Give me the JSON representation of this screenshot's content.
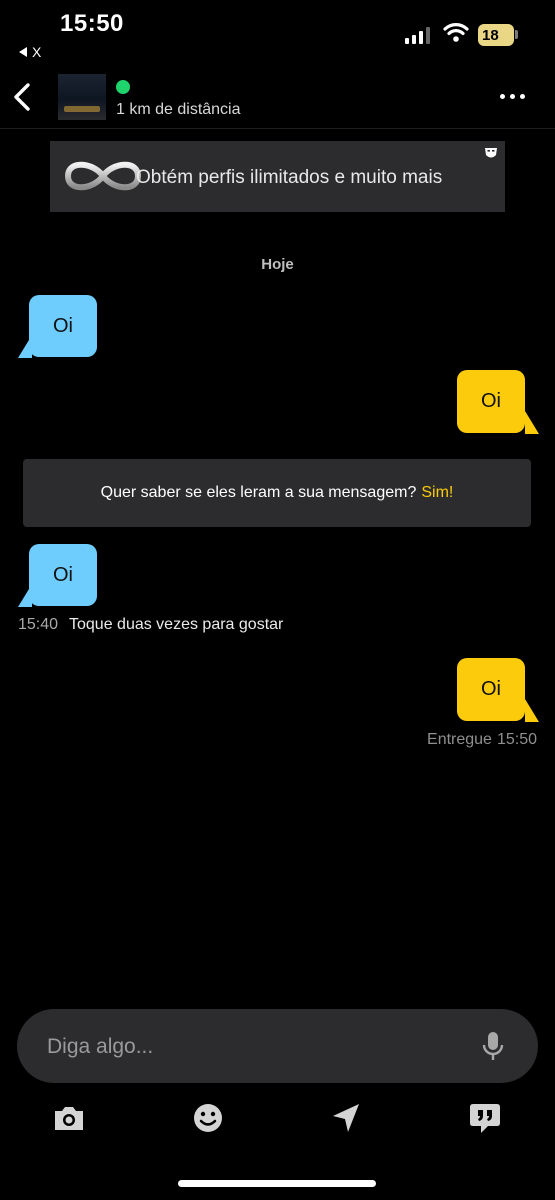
{
  "status_bar": {
    "time": "15:50",
    "back_app": "X",
    "battery": "18"
  },
  "header": {
    "distance": "1 km de distância"
  },
  "promo": {
    "text": "Obtém perfis ilimitados e muito mais"
  },
  "chat": {
    "date_divider": "Hoje",
    "messages": [
      {
        "from": "them",
        "text": "Oi"
      },
      {
        "from": "me",
        "text": "Oi"
      },
      {
        "from": "them",
        "text": "Oi"
      },
      {
        "from": "me",
        "text": "Oi"
      }
    ],
    "read_receipt_prompt": "Quer saber se eles leram a sua mensagem?",
    "read_receipt_cta": "Sim!",
    "incoming_time": "15:40",
    "incoming_hint": "Toque duas vezes para gostar",
    "delivered_label": "Entregue",
    "delivered_time": "15:50"
  },
  "composer": {
    "placeholder": "Diga algo..."
  },
  "toolbar": [
    "camera-icon",
    "smiley-icon",
    "location-arrow-icon",
    "quote-bubble-icon"
  ],
  "colors": {
    "incoming": "#6ecdfd",
    "outgoing": "#fbcb0c",
    "online": "#1fd36d",
    "cta": "#fbcb0c"
  }
}
